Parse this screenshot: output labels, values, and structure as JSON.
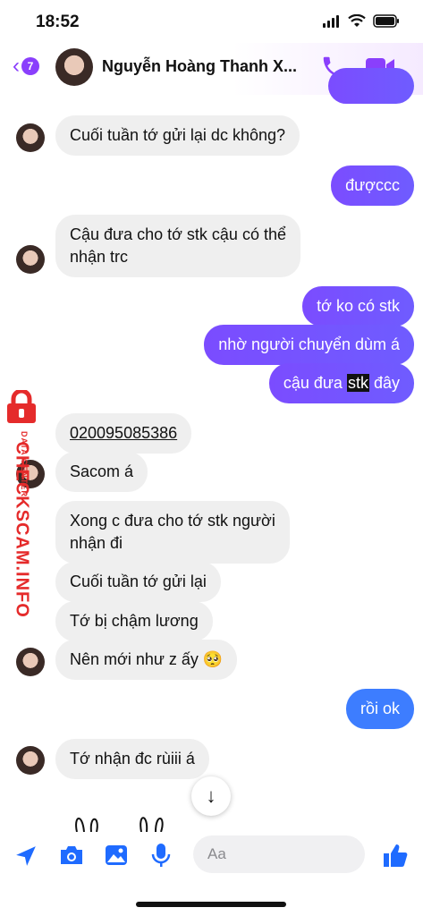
{
  "status": {
    "time": "18:52"
  },
  "header": {
    "back_count": "7",
    "contact_name": "Nguyễn Hoàng Thanh X..."
  },
  "messages": [
    {
      "side": "in",
      "text": "Cuối tuần tớ gửi lại dc không?"
    },
    {
      "side": "out",
      "text": "đượccc"
    },
    {
      "side": "in",
      "line1": "Cậu đưa cho tớ stk cậu có thể",
      "line2": "nhận trc"
    },
    {
      "side": "out",
      "text": "tớ ko có stk"
    },
    {
      "side": "out",
      "text": "nhờ người chuyển dùm á"
    },
    {
      "side": "out",
      "pre": "cậu đưa ",
      "highlight": "stk",
      "post": " đây"
    },
    {
      "side": "in",
      "text": "020095085386"
    },
    {
      "side": "in",
      "text": "Sacom á"
    },
    {
      "side": "in",
      "line1": "Xong c đưa cho tớ stk người",
      "line2": "nhận đi"
    },
    {
      "side": "in",
      "text": "Cuối tuần tớ gửi lại"
    },
    {
      "side": "in",
      "text": "Tớ bị chậm lương"
    },
    {
      "side": "in",
      "text": "Nên mới như z ấy 🥺"
    },
    {
      "side": "out",
      "text": "rồi ok"
    },
    {
      "side": "in",
      "text": "Tớ nhận đc rùiii á"
    }
  ],
  "watermark": {
    "main": "CHECKSCAM.INFO",
    "sub": "DATA CENTER"
  },
  "composer": {
    "placeholder": "Aa"
  },
  "colors": {
    "accent": "#8a3ffc",
    "outgoing": "#7b4cff",
    "blue": "#3d7dff",
    "watermark": "#e52b2b"
  }
}
